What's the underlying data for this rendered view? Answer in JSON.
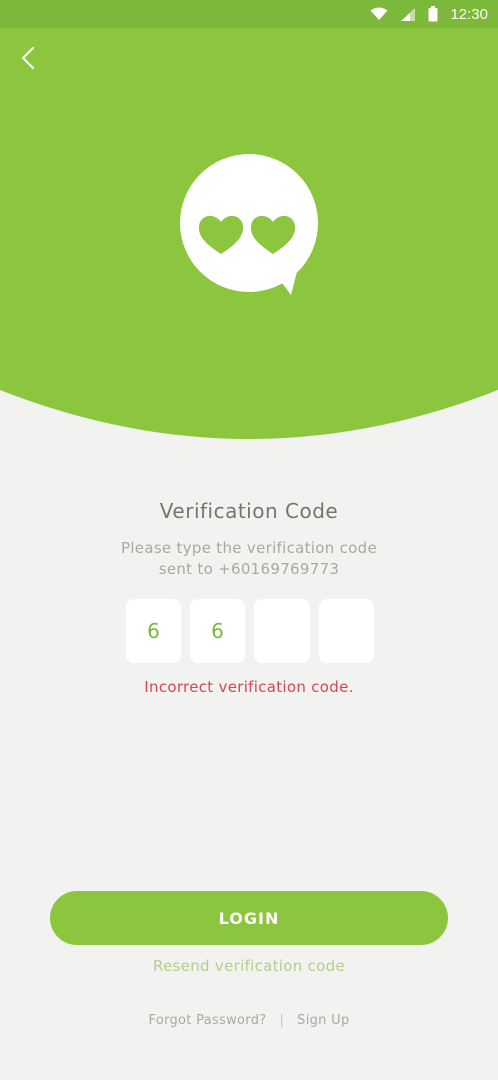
{
  "status_bar": {
    "time": "12:30",
    "icons": [
      "wifi-icon",
      "cell-signal-icon",
      "battery-icon"
    ]
  },
  "header": {
    "back_icon": "chevron-left-icon",
    "logo_icon": "chat-bubble-hearts-icon"
  },
  "verification": {
    "title": "Verification Code",
    "subtitle_line1": "Please type the verification code",
    "subtitle_line2": "sent to +60169769773",
    "digits": [
      "6",
      "6",
      "",
      ""
    ],
    "error": "Incorrect verification code."
  },
  "actions": {
    "login_label": "LOGIN",
    "resend_label": "Resend verification code"
  },
  "footer": {
    "forgot_password": "Forgot Password?",
    "separator": "|",
    "sign_up": "Sign Up"
  },
  "colors": {
    "brand_green": "#8cc63f",
    "status_bar_green": "#7cb83a",
    "background": "#f2f2f0",
    "error_red": "#d8474f",
    "title_gray": "#76766f"
  }
}
